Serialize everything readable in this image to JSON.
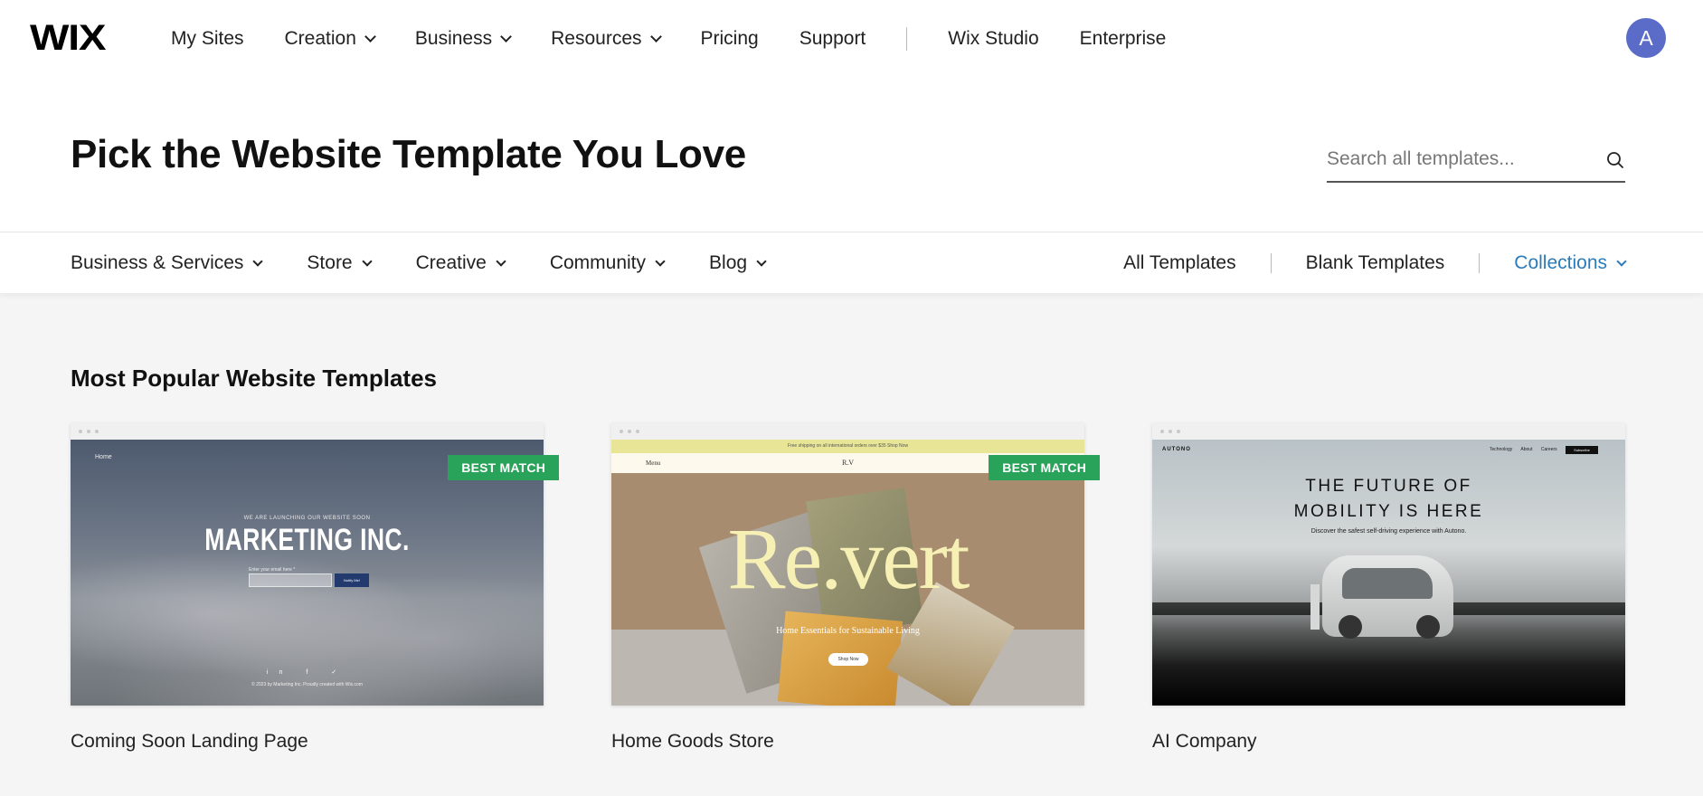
{
  "topnav": {
    "logo": "WIX",
    "items": [
      {
        "label": "My Sites",
        "dropdown": false
      },
      {
        "label": "Creation",
        "dropdown": true
      },
      {
        "label": "Business",
        "dropdown": true
      },
      {
        "label": "Resources",
        "dropdown": true
      },
      {
        "label": "Pricing",
        "dropdown": false
      },
      {
        "label": "Support",
        "dropdown": false
      }
    ],
    "secondary": [
      {
        "label": "Wix Studio"
      },
      {
        "label": "Enterprise"
      }
    ],
    "avatar_initial": "A",
    "avatar_color": "#5a6cc8"
  },
  "hero": {
    "title": "Pick the Website Template You Love",
    "search_placeholder": "Search all templates..."
  },
  "categories": {
    "items": [
      {
        "label": "Business & Services"
      },
      {
        "label": "Store"
      },
      {
        "label": "Creative"
      },
      {
        "label": "Community"
      },
      {
        "label": "Blog"
      }
    ],
    "right": {
      "all_templates": "All Templates",
      "blank_templates": "Blank Templates",
      "collections": "Collections"
    },
    "accent_color": "#2b7bb9"
  },
  "section": {
    "title": "Most Popular Website Templates"
  },
  "templates": [
    {
      "name": "Coming Soon Landing Page",
      "badge": "BEST MATCH",
      "thumb": {
        "nav": "Home",
        "eyebrow": "WE ARE LAUNCHING OUR WEBSITE SOON",
        "headline": "MARKETING INC.",
        "email_label": "Enter your email here *",
        "button": "Notify Me!",
        "social": "in f ✓",
        "footer": "© 2023 by Marketing Inc. Proudly created with Wix.com"
      }
    },
    {
      "name": "Home Goods Store",
      "badge": "BEST MATCH",
      "thumb": {
        "promo": "Free shipping on all international orders over $35 Shop Now",
        "menu": "Menu",
        "logo": "R.V",
        "headline": "Re.vert",
        "subtitle": "Home Essentials for Sustainable Living",
        "button": "Shop Now"
      }
    },
    {
      "name": "AI Company",
      "badge": "",
      "thumb": {
        "brand": "AUTONO",
        "links": "Technology About Careers",
        "button": "Subscribe",
        "headline_1": "THE FUTURE OF",
        "headline_2": "MOBILITY IS HERE",
        "subtitle": "Discover the safest self-driving experience with Autono."
      }
    }
  ],
  "badge_color": "#2aa35a"
}
